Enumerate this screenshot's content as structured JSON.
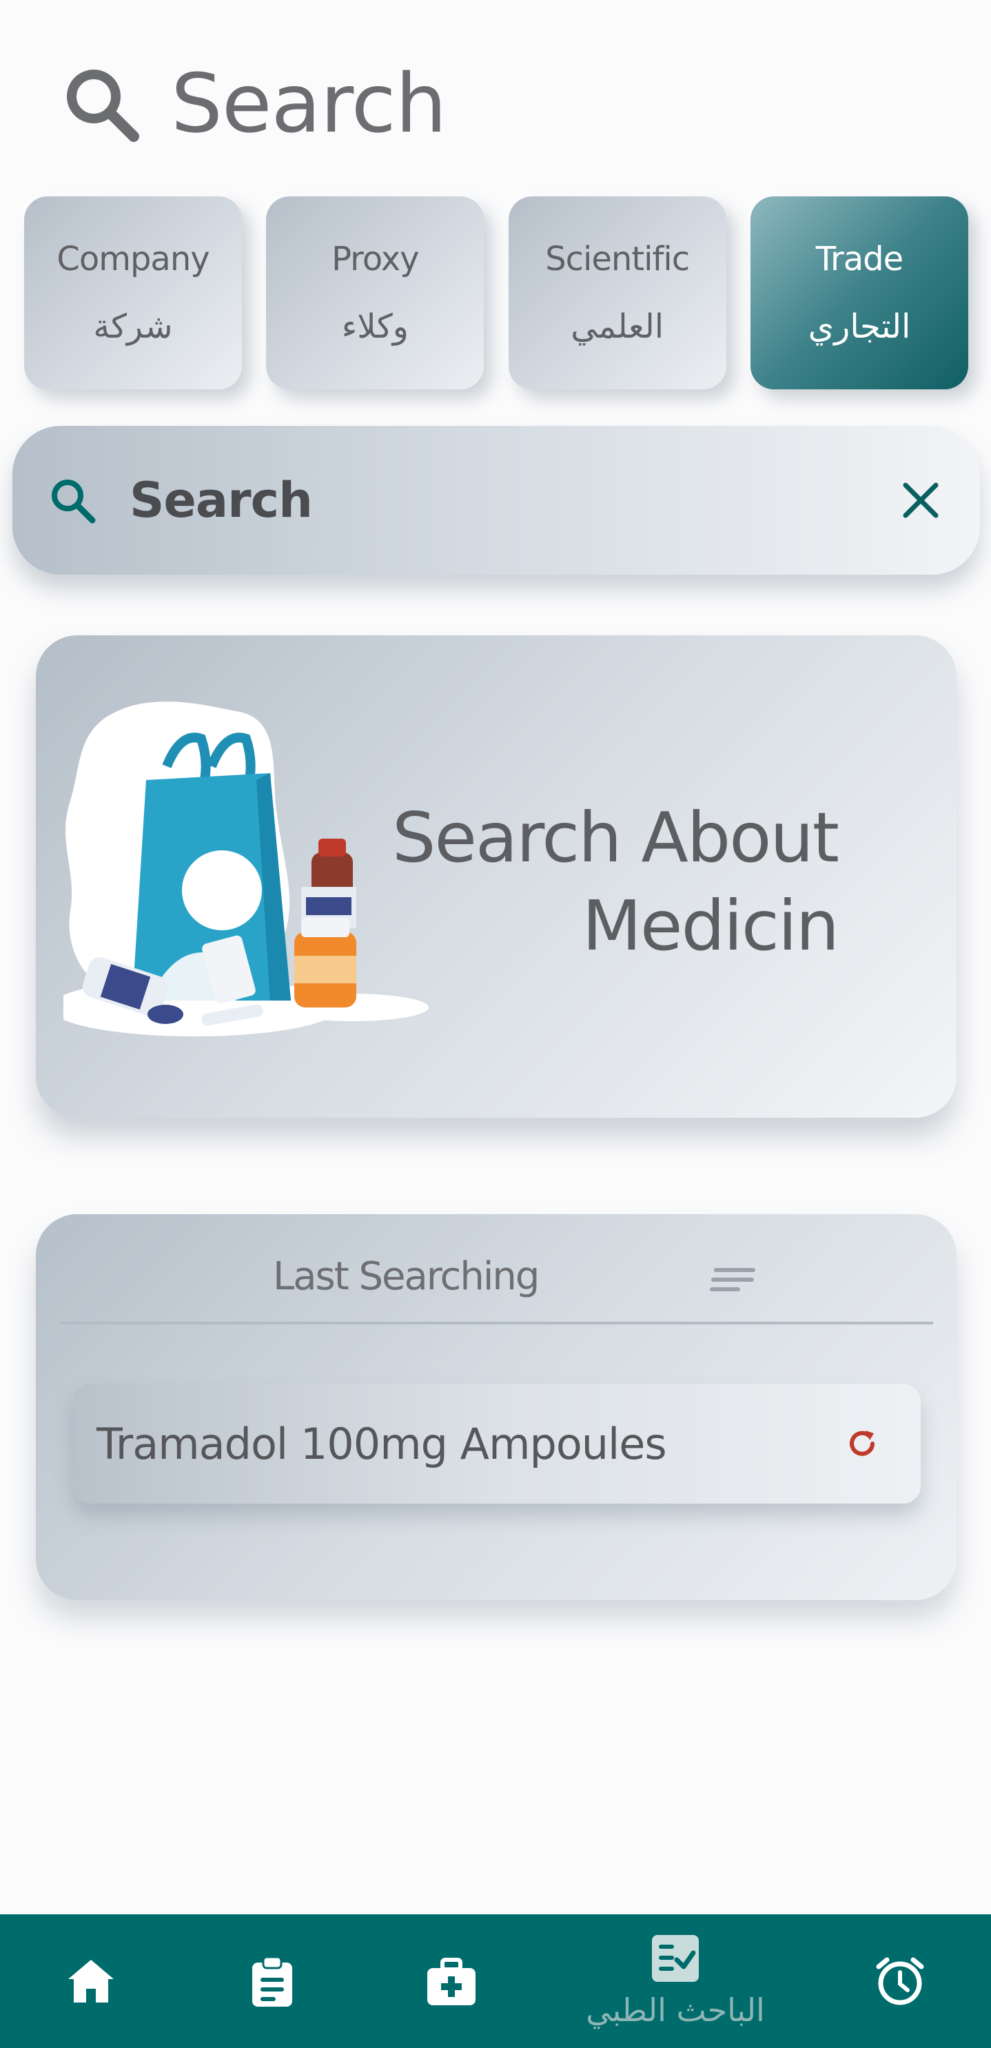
{
  "header": {
    "title": "Search",
    "icon": "search-icon"
  },
  "tabs": [
    {
      "en": "Company",
      "ar": "شركة",
      "active": false
    },
    {
      "en": "Proxy",
      "ar": "وكلاء",
      "active": false
    },
    {
      "en": "Scientific",
      "ar": "العلمي",
      "active": false
    },
    {
      "en": "Trade",
      "ar": "التجاري",
      "active": true
    }
  ],
  "search": {
    "placeholder": "Search",
    "search_icon": "search-icon",
    "clear_icon": "close-icon"
  },
  "hero": {
    "line1": "Search About",
    "line2": "Medicin",
    "image": "medicine-bag-illustration"
  },
  "last_searching": {
    "title": "Last Searching",
    "items": [
      {
        "label": "Tramadol 100mg Ampoules",
        "icon": "refresh-icon"
      }
    ]
  },
  "bottom_nav": {
    "items": [
      {
        "icon": "home-icon"
      },
      {
        "icon": "clipboard-icon"
      },
      {
        "icon": "medical-kit-icon"
      },
      {
        "icon": "checklist-icon",
        "label": "الباحث الطبي",
        "active": true
      },
      {
        "icon": "alarm-clock-icon"
      }
    ]
  },
  "colors": {
    "primary": "#006b6b",
    "accent": "#0f5f63",
    "refresh": "#c0392b",
    "text": "#6b6d70"
  }
}
